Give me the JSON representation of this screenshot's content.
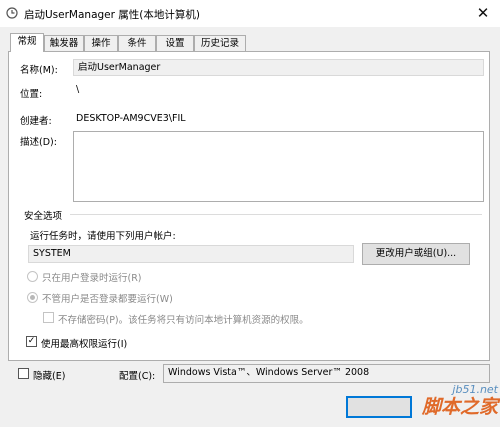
{
  "window": {
    "title": "启动UserManager 属性(本地计算机)",
    "close_glyph": "✕"
  },
  "tabs": [
    {
      "label": "常规",
      "active": true
    },
    {
      "label": "触发器",
      "active": false
    },
    {
      "label": "操作",
      "active": false
    },
    {
      "label": "条件",
      "active": false
    },
    {
      "label": "设置",
      "active": false
    },
    {
      "label": "历史记录",
      "active": false
    }
  ],
  "general": {
    "name_label": "名称(M):",
    "name_value": "启动UserManager",
    "location_label": "位置:",
    "location_value": "\\",
    "author_label": "创建者:",
    "author_value": "DESKTOP-AM9CVE3\\FIL",
    "description_label": "描述(D):",
    "description_value": ""
  },
  "security": {
    "group_label": "安全选项",
    "run_as_label": "运行任务时，请使用下列用户帐户:",
    "user_account": "SYSTEM",
    "change_user_button": "更改用户或组(U)...",
    "radio_logged_on": "只在用户登录时运行(R)",
    "radio_whether_logged": "不管用户是否登录都要运行(W)",
    "do_not_store_password": "不存储密码(P)。该任务将只有访问本地计算机资源的权限。",
    "highest_privileges": "使用最高权限运行(I)",
    "highest_privileges_checkmark": "✓"
  },
  "footer": {
    "hidden_label": "隐藏(E)",
    "configure_label": "配置(C):",
    "configure_value": "Windows Vista™、Windows Server™ 2008"
  },
  "watermark": {
    "site": "jb51.net",
    "text": "脚本之家"
  }
}
